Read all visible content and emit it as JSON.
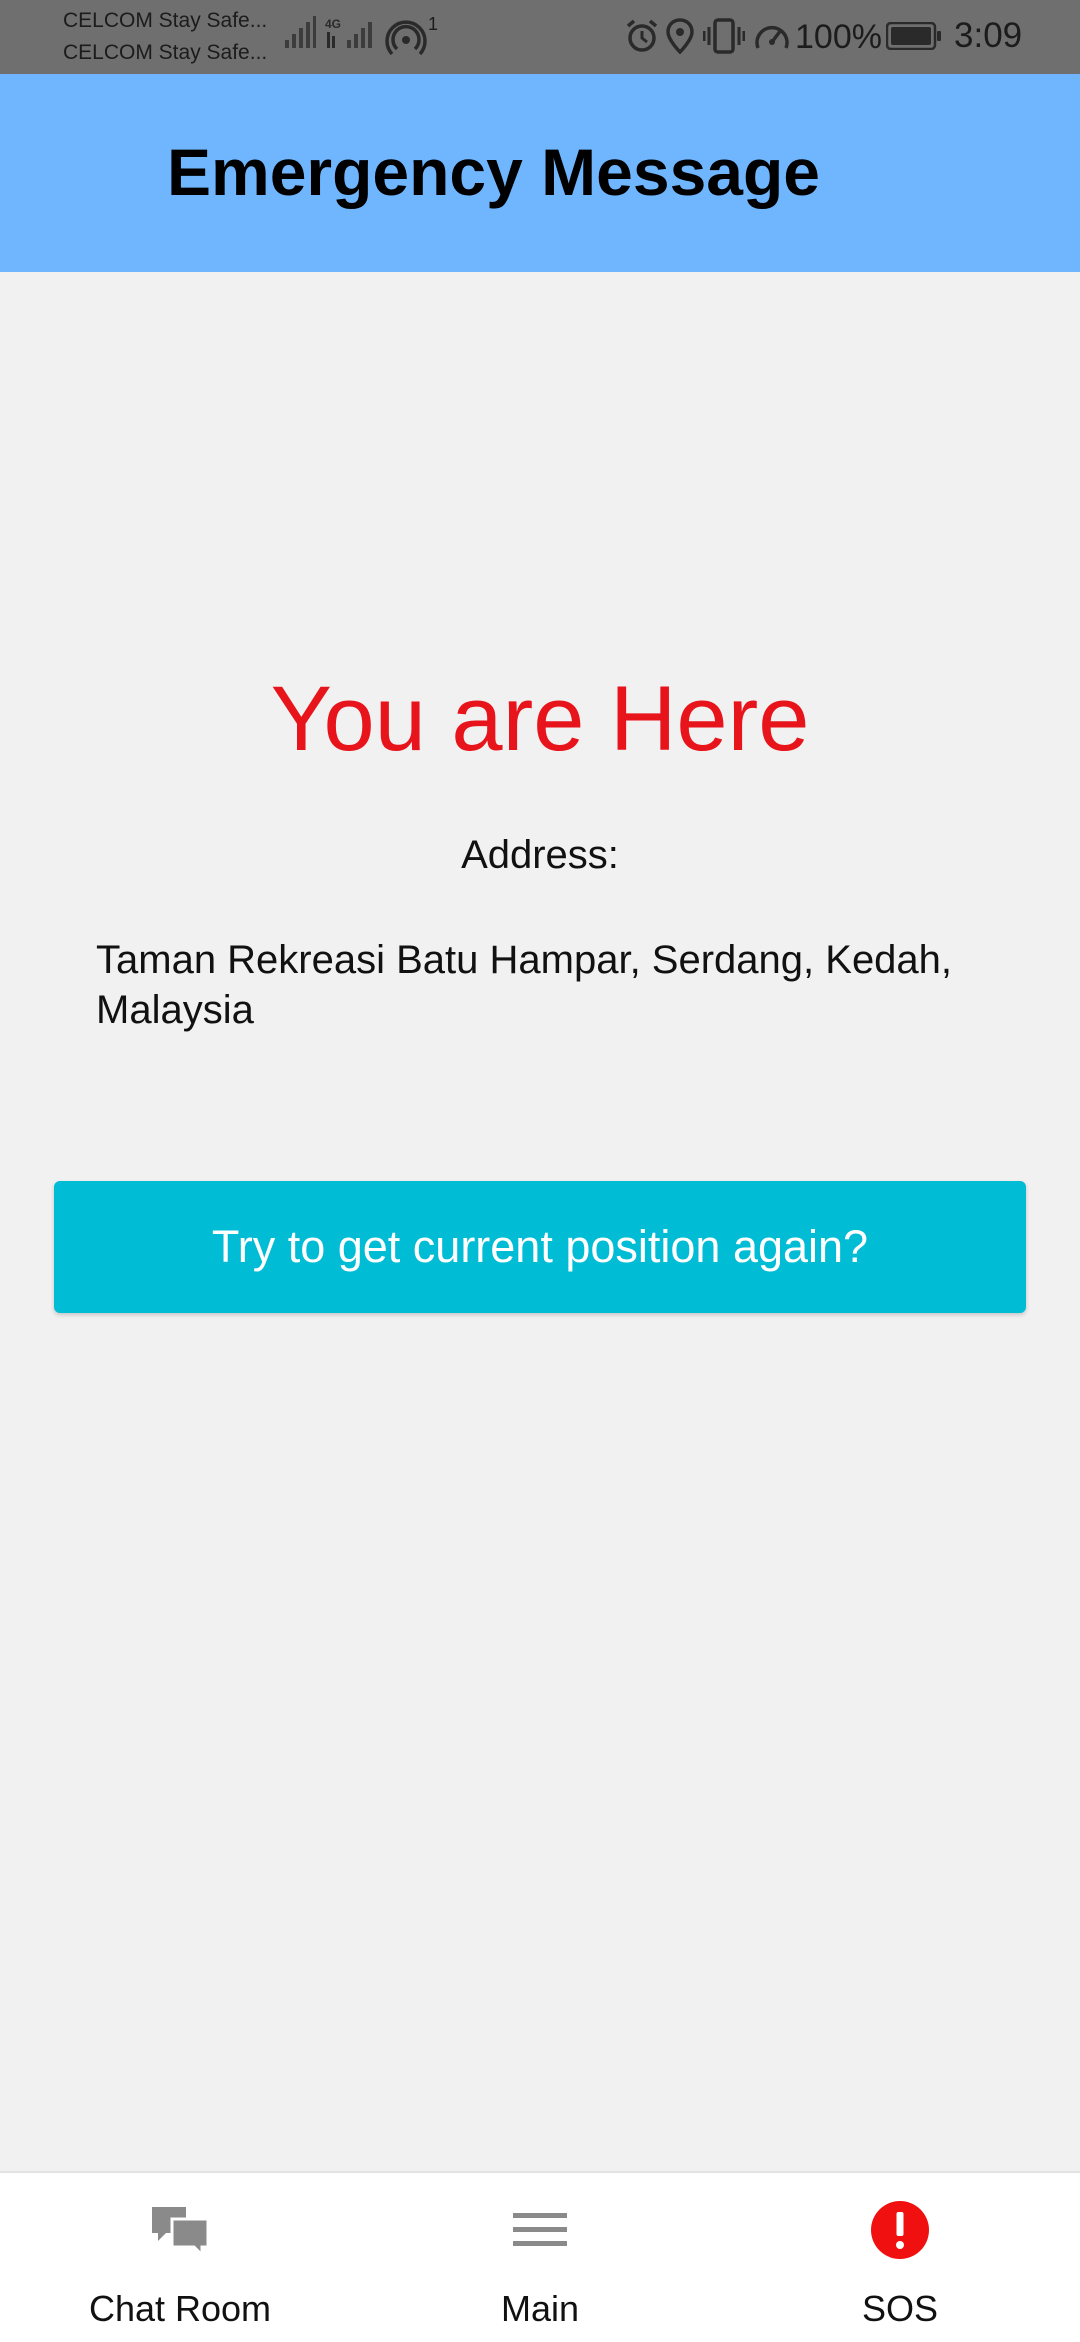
{
  "status_bar": {
    "carrier_1": "CELCOM Stay Safe...",
    "carrier_2": "CELCOM Stay Safe...",
    "network_type": "4G",
    "hotspot_count": "1",
    "battery_percent": "100%",
    "time": "3:09",
    "icons": [
      "signal-icon",
      "signal-4g-icon",
      "hotspot-icon",
      "alarm-icon",
      "location-icon",
      "vibrate-icon",
      "data-saver-icon",
      "battery-icon"
    ]
  },
  "header": {
    "title": "Emergency Message",
    "background_color": "#6fb6ff"
  },
  "main": {
    "heading": "You are Here",
    "heading_color": "#e8141b",
    "address_label": "Address:",
    "address": "Taman Rekreasi Batu Hampar, Serdang, Kedah, Malaysia",
    "retry_button_label": "Try to get current position again?",
    "retry_button_color": "#00bcd4"
  },
  "bottom_nav": {
    "items": [
      {
        "label": "Chat Room",
        "icon": "chat-icon"
      },
      {
        "label": "Main",
        "icon": "menu-icon"
      },
      {
        "label": "SOS",
        "icon": "sos-alert-icon"
      }
    ],
    "sos_color": "#f01010"
  }
}
